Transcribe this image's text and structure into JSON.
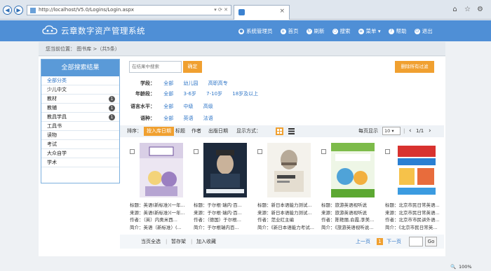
{
  "browser": {
    "address": "http://localhost/V5.0/Logins/Login.aspx",
    "addr_controls": "▾ ⟳ ✕"
  },
  "app": {
    "title": "云章数字资产管理系统",
    "menu": [
      {
        "label": "系统管理员",
        "icon": "user-icon"
      },
      {
        "label": "首页",
        "icon": "home-icon"
      },
      {
        "label": "刷新",
        "icon": "refresh-icon"
      },
      {
        "label": "搜索",
        "icon": "search-icon"
      },
      {
        "label": "菜单 ▾",
        "icon": "menu-icon"
      },
      {
        "label": "帮助",
        "icon": "help-icon"
      },
      {
        "label": "退出",
        "icon": "exit-icon"
      }
    ]
  },
  "breadcrumb": {
    "text": "您当前位置：  图书库 >（共5条）"
  },
  "sidebar": {
    "header": "全部搜索结果",
    "items": [
      {
        "label": "全部分类",
        "badge": ""
      },
      {
        "label": "少儿中文",
        "badge": ""
      },
      {
        "label": "教材",
        "badge": "1"
      },
      {
        "label": "教辅",
        "badge": "1"
      },
      {
        "label": "教具学具",
        "badge": "1"
      },
      {
        "label": "工具书",
        "badge": ""
      },
      {
        "label": "读物",
        "badge": ""
      },
      {
        "label": "考试",
        "badge": ""
      },
      {
        "label": "大众自学",
        "badge": ""
      },
      {
        "label": "学术",
        "badge": ""
      }
    ]
  },
  "search": {
    "placeholder": "在结果中搜索",
    "ok_label": "确定",
    "clear_label": "删除所有过滤"
  },
  "filters": [
    {
      "label": "学段：",
      "options": [
        "全部",
        "幼儿园",
        "高职高专"
      ]
    },
    {
      "label": "年龄段：",
      "options": [
        "全部",
        "3-6岁",
        "7-10岁",
        "18岁及以上"
      ]
    },
    {
      "label": "语言水平：",
      "options": [
        "全部",
        "中级",
        "高级"
      ]
    },
    {
      "label": "语种：",
      "options": [
        "全部",
        "英语",
        "法语"
      ]
    }
  ],
  "sort": {
    "label": "排序：",
    "options": [
      "按入库日期",
      "标题",
      "作者",
      "出版日期"
    ],
    "display_label": "显示方式：",
    "per_page_label": "每页显示",
    "per_page": "10 ▾",
    "pager": "1/1"
  },
  "books": [
    {
      "title": "标题：英语(新标准)(一年...",
      "source": "来源：英语(新标准)(一年...",
      "author": "作者：（英）内奥米西...",
      "summary": "简介：英语（新标准）(..."
    },
    {
      "title": "标题：于尔根·瑞内·百...",
      "source": "来源：于尔根·瑞内·百...",
      "author": "作者：（德国）于尔根...",
      "summary": "简介：于尔根瑞内百..."
    },
    {
      "title": "标题：新日本语能力测试...",
      "source": "来源：新日本语能力测试...",
      "author": "作者：范业红主编",
      "summary": "简介：《新日本语能力考试..."
    },
    {
      "title": "标题：旅游英语视听说",
      "source": "来源：旅游英语视听说",
      "author": "作者：陈艳丽,俞霞,李美...",
      "summary": "简介：《旅游英语视听说..."
    },
    {
      "title": "标题：北京市民日常英语...",
      "source": "来源：北京市民日常英语...",
      "author": "作者：北京市市民讲外语...",
      "summary": "简介：《北京市民日常英..."
    }
  ],
  "bottom": {
    "select_all": "当页全选",
    "temp_shelf": "暂存架",
    "favorite": "加入收藏",
    "prev": "上一页",
    "current": "1",
    "next": "下一页",
    "go": "Go"
  },
  "status": {
    "zoom": "100%"
  },
  "colors": {
    "header": "#4f8fd6",
    "accent": "#f0a030",
    "link": "#2f76c7"
  }
}
